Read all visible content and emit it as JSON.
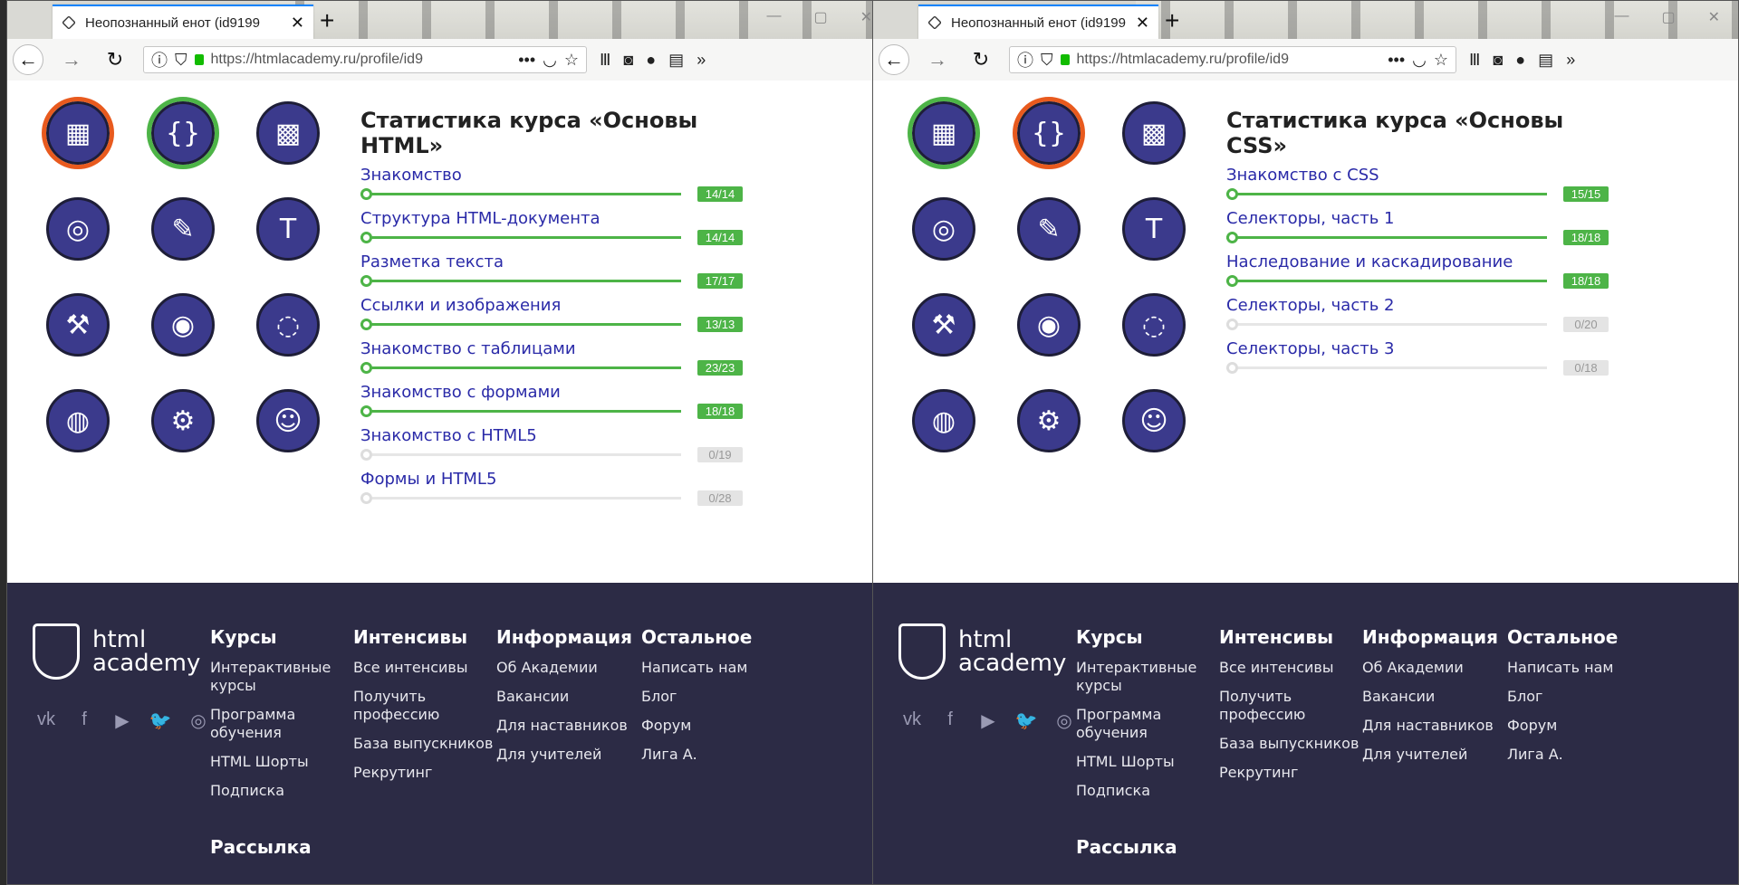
{
  "browser": {
    "tab_title": "Неопознанный енот (id9199",
    "url": "https://htmlacademy.ru/profile/id9"
  },
  "left_course": {
    "title": "Статистика курса «Основы HTML»",
    "rows": [
      {
        "name": "Знакомство",
        "count": "14/14",
        "done": 1.0
      },
      {
        "name": "Структура HTML-документа",
        "count": "14/14",
        "done": 1.0
      },
      {
        "name": "Разметка текста",
        "count": "17/17",
        "done": 1.0
      },
      {
        "name": "Ссылки и изображения",
        "count": "13/13",
        "done": 1.0
      },
      {
        "name": "Знакомство с таблицами",
        "count": "23/23",
        "done": 1.0
      },
      {
        "name": "Знакомство с формами",
        "count": "18/18",
        "done": 1.0
      },
      {
        "name": "Знакомство с HTML5",
        "count": "0/19",
        "done": 0.0
      },
      {
        "name": "Формы и HTML5",
        "count": "0/28",
        "done": 0.0
      }
    ]
  },
  "right_course": {
    "title": "Статистика курса «Основы CSS»",
    "rows": [
      {
        "name": "Знакомство с CSS",
        "count": "15/15",
        "done": 1.0
      },
      {
        "name": "Селекторы, часть 1",
        "count": "18/18",
        "done": 1.0
      },
      {
        "name": "Наследование и каскадирование",
        "count": "18/18",
        "done": 1.0
      },
      {
        "name": "Селекторы, часть 2",
        "count": "0/20",
        "done": 0.0
      },
      {
        "name": "Селекторы, часть 3",
        "count": "0/18",
        "done": 0.0
      }
    ]
  },
  "badges": [
    {
      "icon": "lego-brick-icon",
      "glyph": "▦"
    },
    {
      "icon": "curly-braces-icon",
      "glyph": "{}"
    },
    {
      "icon": "rubiks-cube-icon",
      "glyph": "▩"
    },
    {
      "icon": "football-field-icon",
      "glyph": "◎"
    },
    {
      "icon": "paint-brush-icon",
      "glyph": "✎"
    },
    {
      "icon": "typography-t-icon",
      "glyph": "T"
    },
    {
      "icon": "anvil-icon",
      "glyph": "⚒"
    },
    {
      "icon": "remote-control-icon",
      "glyph": "◉"
    },
    {
      "icon": "bezier-circle-icon",
      "glyph": "◌"
    },
    {
      "icon": "globe-icon",
      "glyph": "◍"
    },
    {
      "icon": "chainsaw-icon",
      "glyph": "⚙"
    },
    {
      "icon": "raccoon-cat-icon",
      "glyph": "☺"
    }
  ],
  "footer": {
    "logo_line1": "html",
    "logo_line2": "academy",
    "social": [
      "vk-icon",
      "facebook-icon",
      "youtube-icon",
      "twitter-icon",
      "instagram-icon"
    ],
    "cols": [
      {
        "title": "Курсы",
        "links": [
          "Интерактивные курсы",
          "Программа обучения",
          "HTML Шорты",
          "Подписка"
        ]
      },
      {
        "title": "Интенсивы",
        "links": [
          "Все интенсивы",
          "Получить профессию",
          "База выпускников",
          "Рекрутинг"
        ]
      },
      {
        "title": "Информация",
        "links": [
          "Об Академии",
          "Вакансии",
          "Для наставников",
          "Для учителей"
        ]
      },
      {
        "title": "Остальное",
        "links": [
          "Написать нам",
          "Блог",
          "Форум",
          "Лига А."
        ]
      }
    ],
    "newsletter": "Рассылка"
  },
  "colors": {
    "accent_green": "#4db447",
    "link_blue": "#2a2aa8",
    "footer_bg": "#2c2b45",
    "badge_blue": "#3b3a8c",
    "progress_orange": "#e85a1e"
  }
}
